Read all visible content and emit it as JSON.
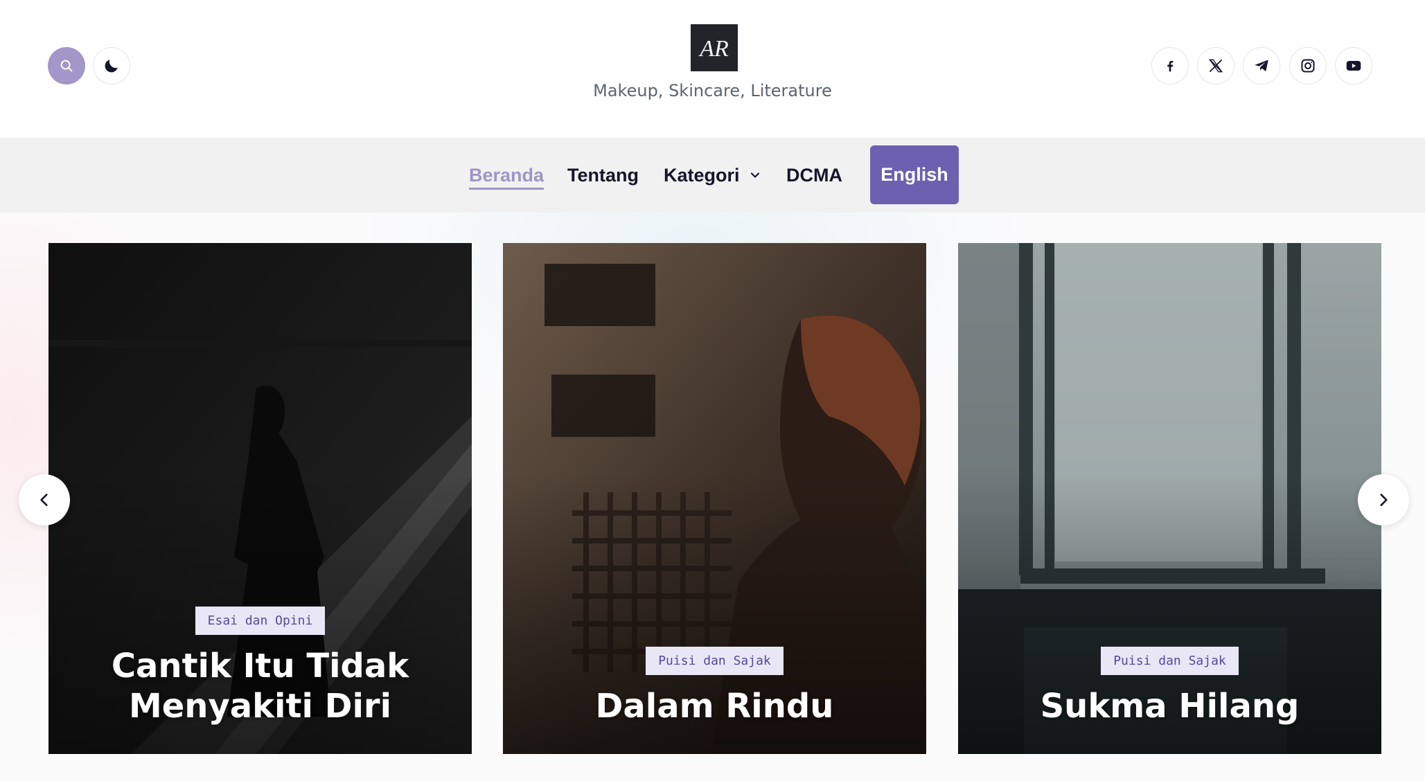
{
  "header": {
    "logo_text": "AR",
    "tagline": "Makeup, Skincare, Literature",
    "search_icon": "search-icon",
    "theme_icon": "moon-icon",
    "social": [
      {
        "name": "facebook",
        "icon": "facebook-icon"
      },
      {
        "name": "x",
        "icon": "x-icon"
      },
      {
        "name": "telegram",
        "icon": "telegram-icon"
      },
      {
        "name": "instagram",
        "icon": "instagram-icon"
      },
      {
        "name": "youtube",
        "icon": "youtube-icon"
      }
    ]
  },
  "nav": {
    "items": [
      {
        "label": "Beranda",
        "active": true
      },
      {
        "label": "Tentang",
        "active": false
      },
      {
        "label": "Kategori",
        "active": false,
        "has_dropdown": true
      },
      {
        "label": "DCMA",
        "active": false
      }
    ],
    "cta_label": "English"
  },
  "slider": {
    "cards": [
      {
        "category": "Esai dan Opini",
        "title": "Cantik Itu Tidak Menyakiti Diri"
      },
      {
        "category": "Puisi dan Sajak",
        "title": "Dalam Rindu"
      },
      {
        "category": "Puisi dan Sajak",
        "title": "Sukma Hilang"
      }
    ],
    "prev_icon": "chevron-left-icon",
    "next_icon": "chevron-right-icon"
  },
  "colors": {
    "accent": "#6d60b1",
    "accent_light": "#9f95c5",
    "search_bg": "#a396c8",
    "nav_bg": "#f1f1f2",
    "badge_bg": "#e9e6f6",
    "text_dark": "#15152a"
  }
}
